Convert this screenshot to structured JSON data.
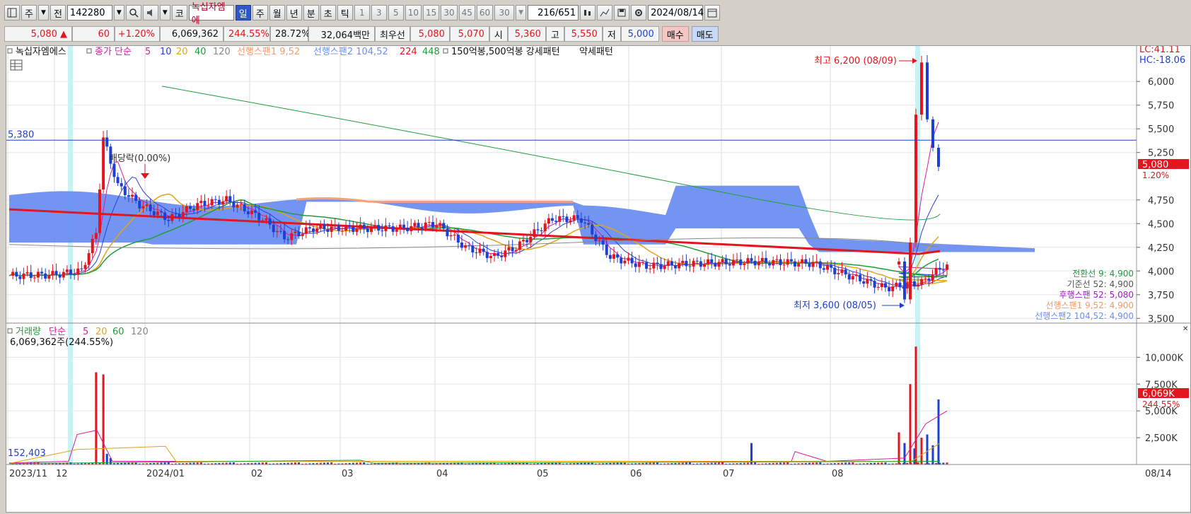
{
  "toolbar": {
    "market_code": "주",
    "market_dd": "",
    "prev": "전",
    "code": "142280",
    "stock_name": "녹십자엠에",
    "periods": [
      "일",
      "주",
      "월",
      "년",
      "분",
      "초",
      "틱"
    ],
    "active_period": "일",
    "nums": [
      "1",
      "3",
      "5",
      "10",
      "15",
      "30",
      "45",
      "60"
    ],
    "count_sel": "30",
    "page": "216",
    "page_total": "/651",
    "date": "2024/08/14",
    "kospi_label": "코"
  },
  "quote": {
    "price": "5,080 ▲",
    "change": "60",
    "change_pct": "+1.20%",
    "volume": "6,069,362",
    "volume_pct": "244.55%",
    "turnover": "28.72%",
    "amount": "32,064백만",
    "best_ask_label": "최우선",
    "best_ask": "5,080",
    "best_bid": "5,070",
    "open_label": "시",
    "open": "5,360",
    "high_label": "고",
    "high": "5,550",
    "low_label": "저",
    "low": "5,000",
    "buy": "매수",
    "sell": "매도"
  },
  "price_legend": {
    "name": "녹십자엠에스",
    "close_label": "종가 단순",
    "ma": [
      "5",
      "10",
      "20",
      "40",
      "120"
    ],
    "span1": "선행스팬1 9,52",
    "span2": "선행스팬2 104,52",
    "n224": "224",
    "n448": "448",
    "pattern": "150억봉,500억봉 강세패턴",
    "weak": "약세패턴"
  },
  "annotations": {
    "high": "최고 6,200 (08/09)",
    "low": "최저 3,600 (08/05)",
    "dividend": "배당락(0.00%)",
    "hline": "5,380",
    "lc": "LC:41.11",
    "hc": "HC:-18.06",
    "cur_price": "5,080",
    "cur_pct": "1.20%",
    "conv": "전환선 9: 4,900",
    "base": "기준선 52: 4,900",
    "lag": "후행스팬 52: 5,080",
    "span1v": "선행스팬1 9,52: 4,900",
    "span2v": "선행스팬2 104,52: 4,900"
  },
  "volume_legend": {
    "label": "거래량",
    "kind": "단순",
    "ma": [
      "5",
      "20",
      "60",
      "120"
    ],
    "current": "6,069,362주(244.55%)",
    "base_vol": "152,403",
    "cur_vol": "6,069K",
    "cur_pct": "244.55%"
  },
  "x_labels": [
    "2023/11",
    "12",
    "2024/01",
    "02",
    "03",
    "04",
    "05",
    "06",
    "07",
    "08"
  ],
  "x_end": "08/14",
  "chart_data": [
    {
      "type": "candlestick",
      "title": "녹십자엠에스",
      "y_ticks": [
        "6,000",
        "5,750",
        "5,500",
        "5,250",
        "4,750",
        "4,500",
        "4,250",
        "4,000",
        "3,750",
        "3,500"
      ],
      "ylim": [
        3450,
        6300
      ],
      "highest": {
        "value": 6200,
        "date": "08/09"
      },
      "lowest": {
        "value": 3600,
        "date": "08/05"
      },
      "last": {
        "open": 5360,
        "high": 5550,
        "low": 5000,
        "close": 5080
      },
      "reference_line": 5380,
      "series": [
        {
          "name": "종가 단순 5",
          "color": "#d81b9c"
        },
        {
          "name": "10",
          "color": "#2b3fd6"
        },
        {
          "name": "20",
          "color": "#e2a31b"
        },
        {
          "name": "40",
          "color": "#1f9d3a"
        },
        {
          "name": "120",
          "color": "#888888"
        },
        {
          "name": "선행스팬1 9,52",
          "color": "#f29b6b"
        },
        {
          "name": "선행스팬2 104,52",
          "color": "#6d8ff0"
        },
        {
          "name": "224",
          "color": "#e3161f"
        },
        {
          "name": "448",
          "color": "#1f9d3a"
        }
      ],
      "colors": {
        "up": "#e3161f",
        "down": "#1c3fd6",
        "cloud": "#6b8ff0",
        "cloud_down": "#f4a27a"
      }
    },
    {
      "type": "bar",
      "title": "거래량",
      "y_ticks": [
        "10,000K",
        "7,500K",
        "5,000K",
        "2,500K"
      ],
      "ylim": [
        0,
        12000
      ],
      "last_value": 6069
    }
  ]
}
